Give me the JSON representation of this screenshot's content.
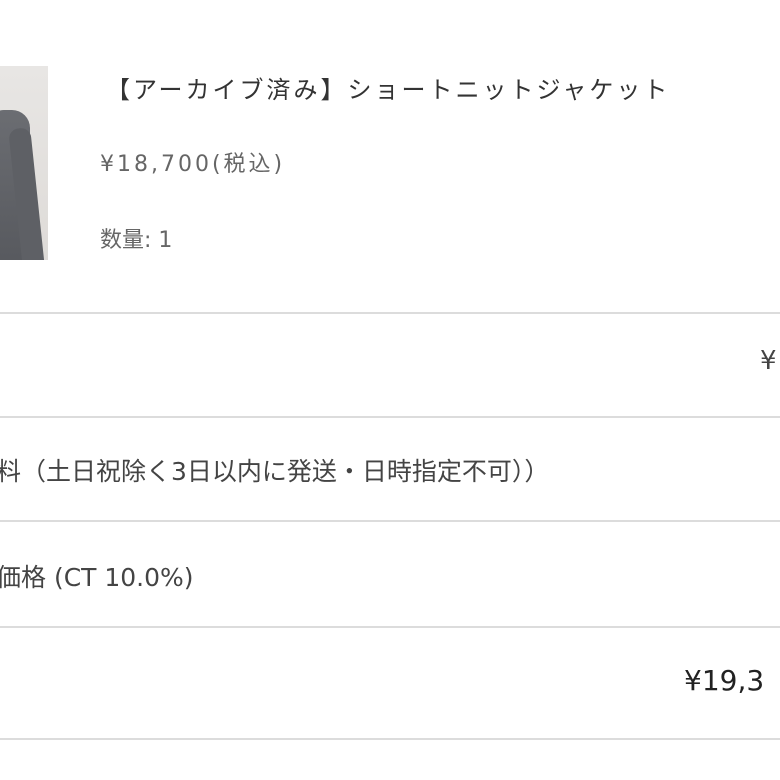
{
  "order_item": {
    "title": "【アーカイブ済み】ショートニットジャケット",
    "price": "¥18,700(税込)",
    "quantity": "数量: 1"
  },
  "summary": {
    "subtotal_value": "¥",
    "shipping_label": "料（土日祝除く3日以内に発送・日時指定不可））",
    "tax_label": "価格 (CT 10.0%)",
    "total_value": "¥19,3"
  },
  "colors": {
    "text": "#333333",
    "muted_text": "#666666",
    "divider": "#dcdcdc",
    "background": "#ffffff"
  }
}
